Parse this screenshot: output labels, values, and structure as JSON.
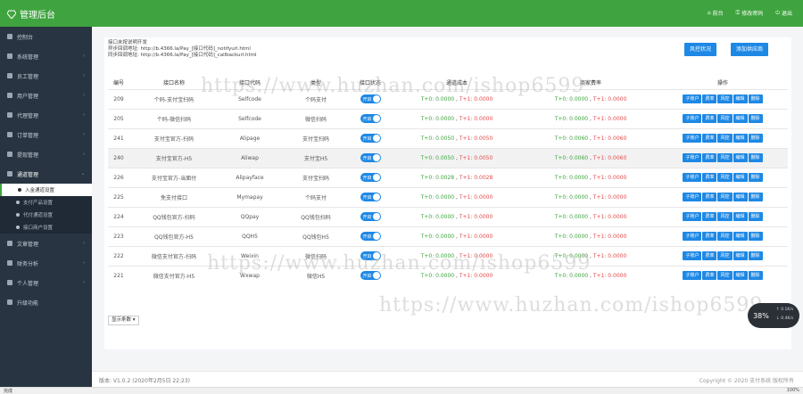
{
  "app": {
    "title": "管理后台"
  },
  "header": {
    "actions": [
      {
        "label": "前台",
        "icon": "home-icon"
      },
      {
        "label": "修改密码",
        "icon": "key-icon"
      },
      {
        "label": "退出",
        "icon": "logout-icon"
      }
    ]
  },
  "sidebar": {
    "items": [
      {
        "label": "控制台",
        "icon": "dashboard-icon"
      },
      {
        "label": "系统管理",
        "icon": "settings-icon",
        "chevron": true
      },
      {
        "label": "员工管理",
        "icon": "staff-icon",
        "chevron": true
      },
      {
        "label": "用户管理",
        "icon": "user-icon",
        "chevron": true
      },
      {
        "label": "代理管理",
        "icon": "agent-icon",
        "chevron": true
      },
      {
        "label": "订单管理",
        "icon": "order-icon",
        "chevron": true
      },
      {
        "label": "提现管理",
        "icon": "withdraw-icon",
        "chevron": true
      },
      {
        "label": "通道管理",
        "icon": "channel-icon",
        "chevron": true,
        "open": true
      }
    ],
    "submenu": [
      {
        "label": "入金通道设置",
        "active": true
      },
      {
        "label": "支付产品设置"
      },
      {
        "label": "代付通道设置"
      },
      {
        "label": "接口商户设置"
      }
    ],
    "items_after": [
      {
        "label": "文章管理",
        "icon": "article-icon",
        "chevron": true
      },
      {
        "label": "财务分析",
        "icon": "finance-icon",
        "chevron": true
      },
      {
        "label": "个人管理",
        "icon": "profile-icon",
        "chevron": true
      },
      {
        "label": "升级功能",
        "icon": "upgrade-icon",
        "chevron": false
      }
    ]
  },
  "notes": {
    "line1": "接口未按说明开发",
    "line2": "异步回调地址: http://b.4366.la/Pay_[接口代码]_notifyurl.html",
    "line3": "同步回调地址: http://b.4366.la/Pay_[接口代码]_callbackurl.html"
  },
  "buttons": {
    "risk": "风控状况",
    "add": "添加供应商"
  },
  "table": {
    "headers": [
      "编号",
      "接口名称",
      "接口代码",
      "类型",
      "接口状态",
      "通道成本",
      "商家费率",
      "操作"
    ],
    "switch_label": "开启",
    "ops": [
      "子账户",
      "费率",
      "风控",
      "编辑",
      "删除"
    ],
    "rows": [
      {
        "id": "209",
        "name": "个码-支付宝扫码",
        "code": "Selfcode",
        "type": "个码支付",
        "cost_t0": "T+0: 0.0000",
        "cost_t1": "T+1: 0.0000",
        "fee_t0": "T+0: 0.0000",
        "fee_t1": "T+1: 0.0000"
      },
      {
        "id": "205",
        "name": "个码-微信扫码",
        "code": "Selfcode",
        "type": "微信扫码",
        "cost_t0": "T+0: 0.0000",
        "cost_t1": "T+1: 0.0000",
        "fee_t0": "T+0: 0.0000",
        "fee_t1": "T+1: 0.0000"
      },
      {
        "id": "241",
        "name": "支付宝官方-扫码",
        "code": "Alipage",
        "type": "支付宝扫码",
        "cost_t0": "T+0: 0.0050",
        "cost_t1": "T+1: 0.0050",
        "fee_t0": "T+0: 0.0060",
        "fee_t1": "T+1: 0.0060"
      },
      {
        "id": "240",
        "name": "支付宝官方-H5",
        "code": "Aliwap",
        "type": "支付宝H5",
        "cost_t0": "T+0: 0.0050",
        "cost_t1": "T+1: 0.0050",
        "fee_t0": "T+0: 0.0060",
        "fee_t1": "T+1: 0.0060",
        "hl": true
      },
      {
        "id": "226",
        "name": "支付宝官方-当面付",
        "code": "Alipayface",
        "type": "支付宝扫码",
        "cost_t0": "T+0: 0.0028",
        "cost_t1": "T+1: 0.0028",
        "fee_t0": "T+0: 0.0000",
        "fee_t1": "T+1: 0.0000"
      },
      {
        "id": "225",
        "name": "免支付接口",
        "code": "Mymapay",
        "type": "个码支付",
        "cost_t0": "T+0: 0.0000",
        "cost_t1": "T+1: 0.0000",
        "fee_t0": "T+0: 0.0000",
        "fee_t1": "T+1: 0.0000"
      },
      {
        "id": "224",
        "name": "QQ钱包官方-扫码",
        "code": "QQpay",
        "type": "QQ钱包扫码",
        "cost_t0": "T+0: 0.0000",
        "cost_t1": "T+1: 0.0000",
        "fee_t0": "T+0: 0.0000",
        "fee_t1": "T+1: 0.0000"
      },
      {
        "id": "223",
        "name": "QQ钱包官方-H5",
        "code": "QQH5",
        "type": "QQ钱包H5",
        "cost_t0": "T+0: 0.0000",
        "cost_t1": "T+1: 0.0000",
        "fee_t0": "T+0: 0.0000",
        "fee_t1": "T+1: 0.0000"
      },
      {
        "id": "222",
        "name": "微信支付官方-扫码",
        "code": "Weixin",
        "type": "微信扫码",
        "cost_t0": "T+0: 0.0000",
        "cost_t1": "T+1: 0.0000",
        "fee_t0": "T+0: 0.0000",
        "fee_t1": "T+1: 0.0000"
      },
      {
        "id": "221",
        "name": "微信支付官方-H5",
        "code": "Wxwap",
        "type": "微信H5",
        "cost_t0": "T+0: 0.0000",
        "cost_t1": "T+1: 0.0000",
        "fee_t0": "T+0: 0.0000",
        "fee_t1": "T+1: 0.0000"
      }
    ]
  },
  "pager": {
    "label": "显示条数"
  },
  "footer": {
    "version": "版本: V1.0.2 (2020年2月5日 22:23)",
    "copyright": "Copyright © 2020 支付系统 版权所有"
  },
  "watermark": "https://www.huzhan.com/ishop6599",
  "float_widget": {
    "value": "38",
    "unit": "%",
    "up": "0.1K/s",
    "down": "0.4K/s"
  },
  "statusbar": {
    "left": "完成",
    "right": "100%"
  },
  "colors": {
    "header": "#3fa43f",
    "sidebar": "#283442",
    "button": "#1e88e5",
    "t0": "#3fa43f",
    "t1": "#e24b4b"
  }
}
